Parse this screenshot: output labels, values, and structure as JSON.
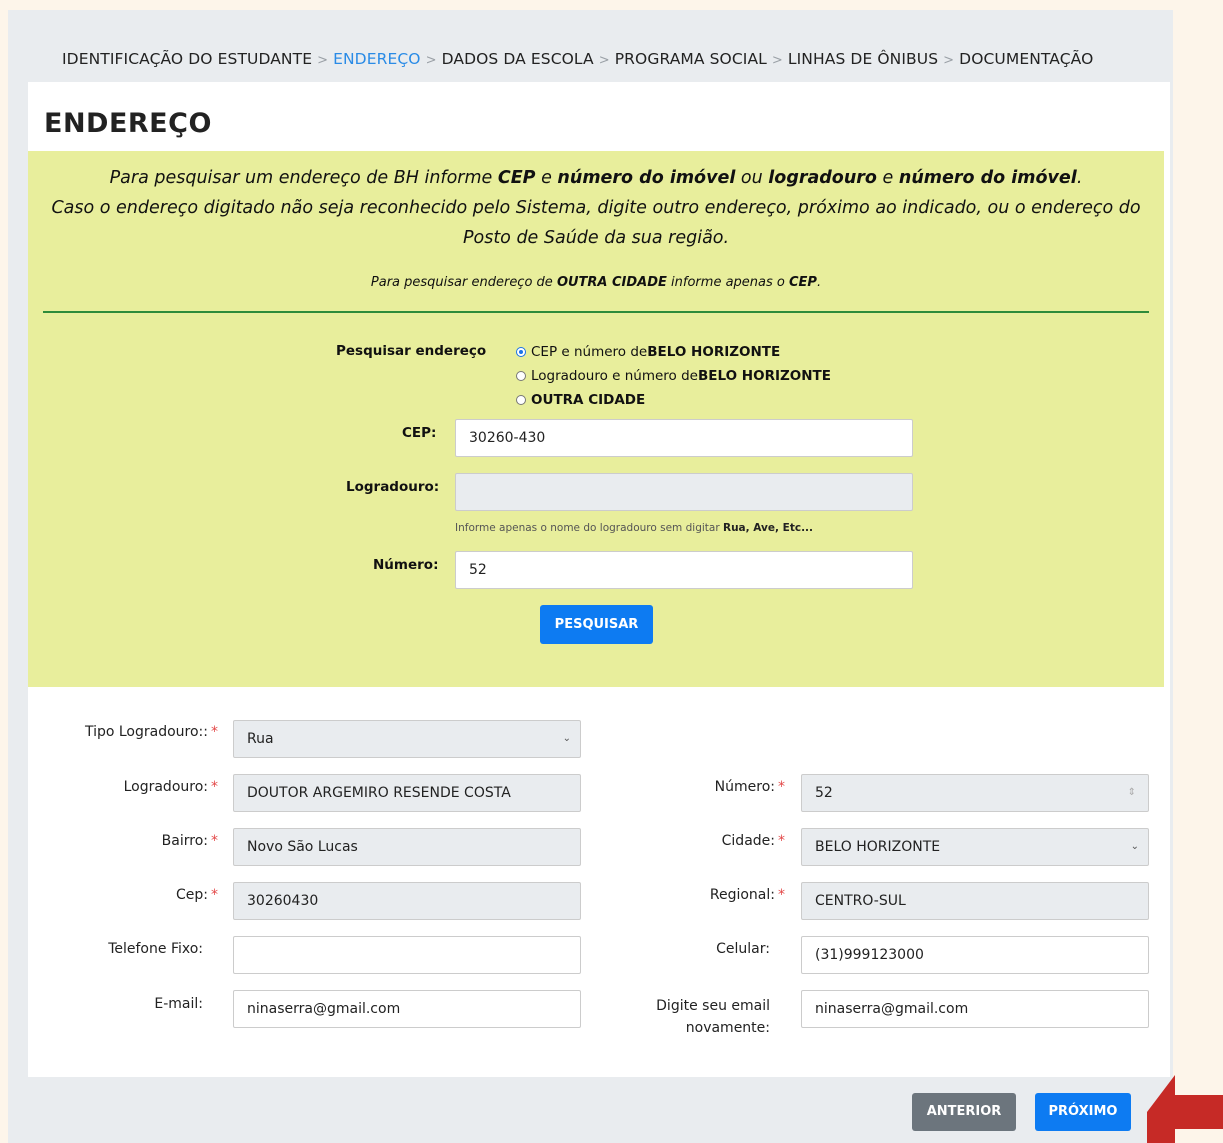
{
  "breadcrumb": {
    "items": [
      "IDENTIFICAÇÃO DO ESTUDANTE",
      "ENDEREÇO",
      "DADOS DA ESCOLA",
      "PROGRAMA SOCIAL",
      "LINHAS DE ÔNIBUS",
      "DOCUMENTAÇÃO"
    ],
    "separator": ">",
    "active_index": 1
  },
  "page_title": "ENDEREÇO",
  "instructions": {
    "line1": {
      "p1": "Para pesquisar um endereço de BH informe ",
      "b1": "CEP",
      "p2": " e ",
      "b2": "número do imóvel",
      "p3": " ou ",
      "b3": "logradouro",
      "p4": " e ",
      "b4": "número do imóvel",
      "p5": "."
    },
    "line2": "Caso o endereço digitado não seja reconhecido pelo Sistema, digite outro endereço, próximo ao indicado, ou o endereço do Posto de Saúde da sua região.",
    "other_city": {
      "p1": "Para pesquisar endereço de ",
      "b1": "OUTRA CIDADE",
      "p2": " informe apenas o ",
      "b2": "CEP",
      "p3": "."
    }
  },
  "search": {
    "label": "Pesquisar endereço",
    "options": [
      {
        "text": "CEP e número de ",
        "bold": "BELO HORIZONTE",
        "checked": true
      },
      {
        "text": "Logradouro e número de ",
        "bold": "BELO HORIZONTE",
        "checked": false
      },
      {
        "text": "",
        "bold": "OUTRA CIDADE",
        "checked": false
      }
    ],
    "cep_label": "CEP:",
    "cep_value": "30260-430",
    "logradouro_label": "Logradouro:",
    "logradouro_value": "",
    "hint_text": "Informe apenas o nome do logradouro sem digitar ",
    "hint_bold": "Rua, Ave, Etc...",
    "numero_label": "Número:",
    "numero_value": "52",
    "button": "PESQUISAR"
  },
  "form": {
    "tipo_logradouro": {
      "label": "Tipo Logradouro::",
      "value": "Rua"
    },
    "logradouro": {
      "label": "Logradouro:",
      "value": "DOUTOR ARGEMIRO RESENDE COSTA"
    },
    "numero": {
      "label": "Número:",
      "value": "52"
    },
    "bairro": {
      "label": "Bairro:",
      "value": "Novo São Lucas"
    },
    "cidade": {
      "label": "Cidade:",
      "value": "BELO HORIZONTE"
    },
    "cep": {
      "label": "Cep:",
      "value": "30260430"
    },
    "regional": {
      "label": "Regional:",
      "value": "CENTRO-SUL"
    },
    "telefone": {
      "label": "Telefone Fixo:",
      "value": ""
    },
    "celular": {
      "label": "Celular:",
      "value": "(31)999123000"
    },
    "email": {
      "label": "E-mail:",
      "value": "ninaserra@gmail.com"
    },
    "email_confirm": {
      "label_line1": "Digite seu email",
      "label_line2": "novamente:",
      "value": "ninaserra@gmail.com"
    },
    "required_mark": "*"
  },
  "nav": {
    "prev": "ANTERIOR",
    "next": "PRÓXIMO"
  },
  "colors": {
    "active_crumb": "#2a8be6",
    "search_bg": "#e8ee9c",
    "primary_button": "#0d7bf2",
    "secondary_button": "#6c757d",
    "annotation_arrow": "#c62a26"
  }
}
